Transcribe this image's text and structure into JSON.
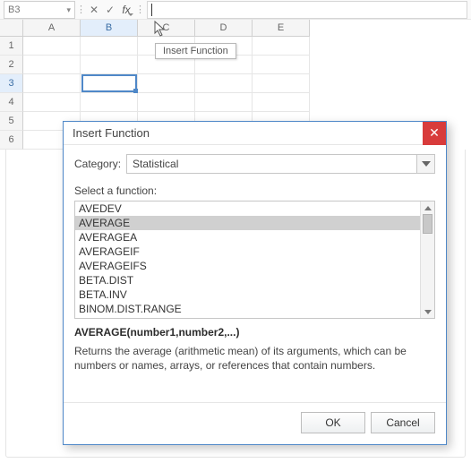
{
  "formula_bar": {
    "namebox_value": "B3",
    "cancel_glyph": "✕",
    "confirm_glyph": "✓",
    "fx_glyph": "fx",
    "input_value": ""
  },
  "tooltip": {
    "text": "Insert Function"
  },
  "grid": {
    "columns": [
      "A",
      "B",
      "C",
      "D",
      "E"
    ],
    "rows": [
      "1",
      "2",
      "3",
      "4",
      "5",
      "6"
    ],
    "active_col": "B",
    "active_row": "3"
  },
  "dialog": {
    "title": "Insert Function",
    "category_label": "Category:",
    "category_value": "Statistical",
    "select_label": "Select a function:",
    "functions": [
      "AVEDEV",
      "AVERAGE",
      "AVERAGEA",
      "AVERAGEIF",
      "AVERAGEIFS",
      "BETA.DIST",
      "BETA.INV",
      "BINOM.DIST.RANGE"
    ],
    "selected_index": 1,
    "signature": "AVERAGE(number1,number2,...)",
    "description": "Returns the average (arithmetic mean) of its arguments, which can be numbers or names, arrays, or references that contain numbers.",
    "ok_label": "OK",
    "cancel_label": "Cancel"
  }
}
